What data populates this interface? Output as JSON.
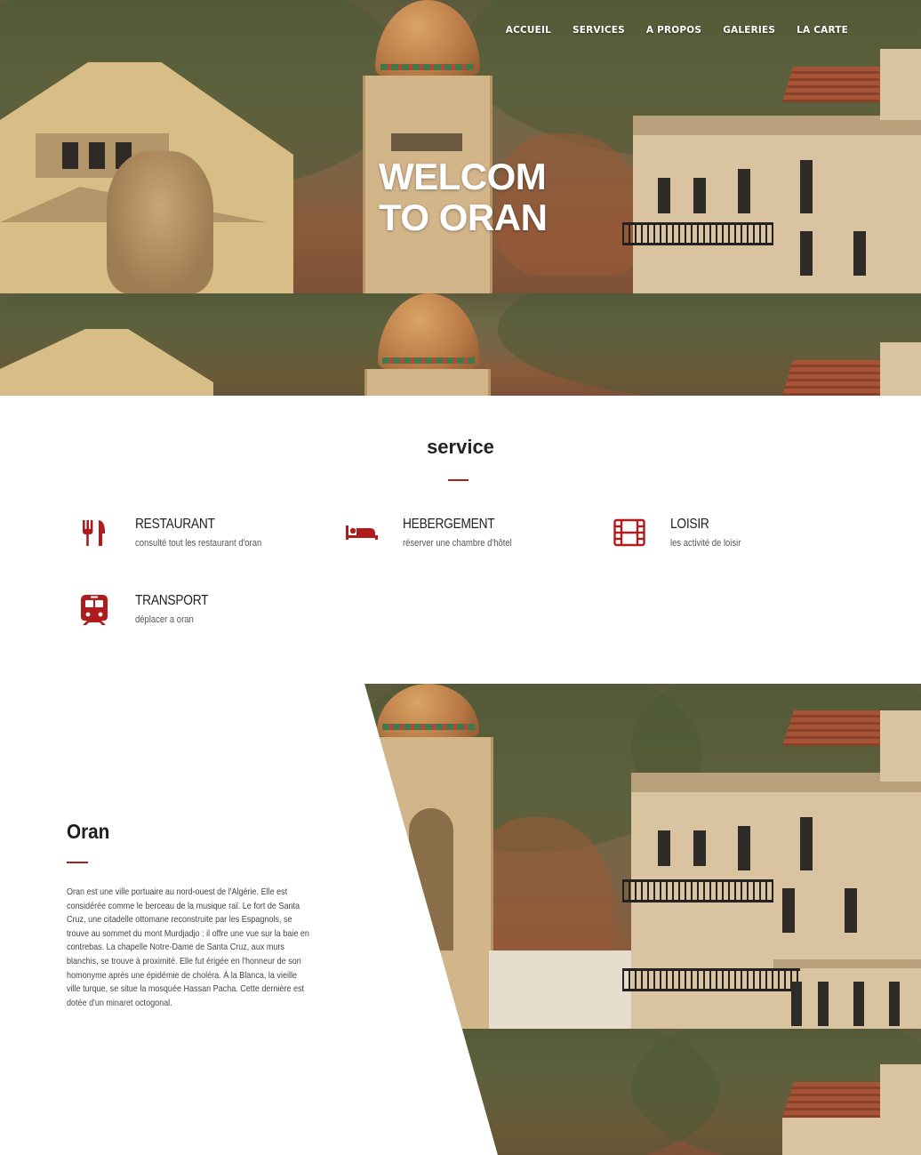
{
  "nav": {
    "items": [
      {
        "label": "ACCUEIL"
      },
      {
        "label": "SERVICES"
      },
      {
        "label": "A PROPOS"
      },
      {
        "label": "GALERIES"
      },
      {
        "label": "LA CARTE"
      }
    ]
  },
  "hero": {
    "title_line1": "WELCOM",
    "title_line2": "TO ORAN"
  },
  "services": {
    "title": "service",
    "accent_color": "#b01b1b",
    "items": [
      {
        "icon": "utensils-icon",
        "name": "RESTAURANT",
        "desc": "consulté tout les restaurant d'oran"
      },
      {
        "icon": "bed-icon",
        "name": "HEBERGEMENT",
        "desc": "réserver une chambre d'hôtel"
      },
      {
        "icon": "film-icon",
        "name": "LOISIR",
        "desc": "les activité de loisir"
      },
      {
        "icon": "train-icon",
        "name": "TRANSPORT",
        "desc": "déplacer a oran"
      }
    ]
  },
  "about": {
    "title": "Oran",
    "text": "Oran est une ville portuaire au nord-ouest de l'Algérie. Elle est considérée comme le berceau de la musique raï. Le fort de Santa Cruz, une citadelle ottomane reconstruite par les Espagnols, se trouve au sommet du mont Murdjadjo : il offre une vue sur la baie en contrebas. La chapelle Notre-Dame de Santa Cruz, aux murs blanchis, se trouve à proximité. Elle fut érigée en l'honneur de son homonyme après une épidémie de choléra. À la Blanca, la vieille ville turque, se situe la mosquée Hassan Pacha. Cette dernière est dotée d'un minaret octogonal."
  }
}
